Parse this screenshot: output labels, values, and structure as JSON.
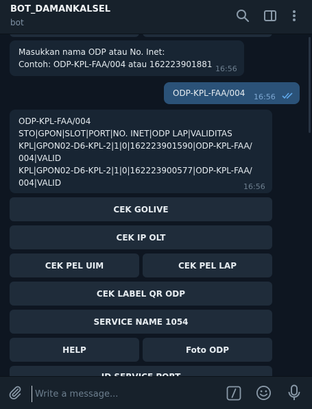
{
  "header": {
    "title": "BOT_DAMANKALSEL",
    "subtitle": "bot"
  },
  "messages": {
    "m1": {
      "text": "Masukkan nama ODP atau No. Inet:\nContoh: ODP-KPL-FAA/004 atau 162223901881",
      "time": "16:56"
    },
    "m2": {
      "text": "ODP-KPL-FAA/004",
      "time": "16:56"
    },
    "m3": {
      "text": "ODP-KPL-FAA/004\nSTO|GPON|SLOT|PORT|NO. INET|ODP LAP|VALIDITAS\nKPL|GPON02-D6-KPL-2|1|0|162223901590|ODP-KPL-FAA/\n004|VALID\nKPL|GPON02-D6-KPL-2|1|0|162223900577|ODP-KPL-FAA/\n004|VALID",
      "time": "16:56"
    }
  },
  "keyboard": {
    "cek_golive": "CEK GOLIVE",
    "cek_ip_olt": "CEK IP OLT",
    "cek_pel_uim": "CEK PEL UIM",
    "cek_pel_lap": "CEK PEL LAP",
    "cek_label_qr_odp": "CEK LABEL QR ODP",
    "service_name": "SERVICE NAME 1054",
    "help": "HELP",
    "foto_odp": "Foto ODP",
    "id_service_port": "ID SERVICE PORT"
  },
  "composer": {
    "placeholder": "Write a message..."
  },
  "colors": {
    "background": "#0e1621",
    "header": "#17212b",
    "incoming_bubble": "#182533",
    "outgoing_bubble": "#2b5278",
    "keyboard_button": "#1f2c3a",
    "read_ticks": "#5fa8ea"
  }
}
